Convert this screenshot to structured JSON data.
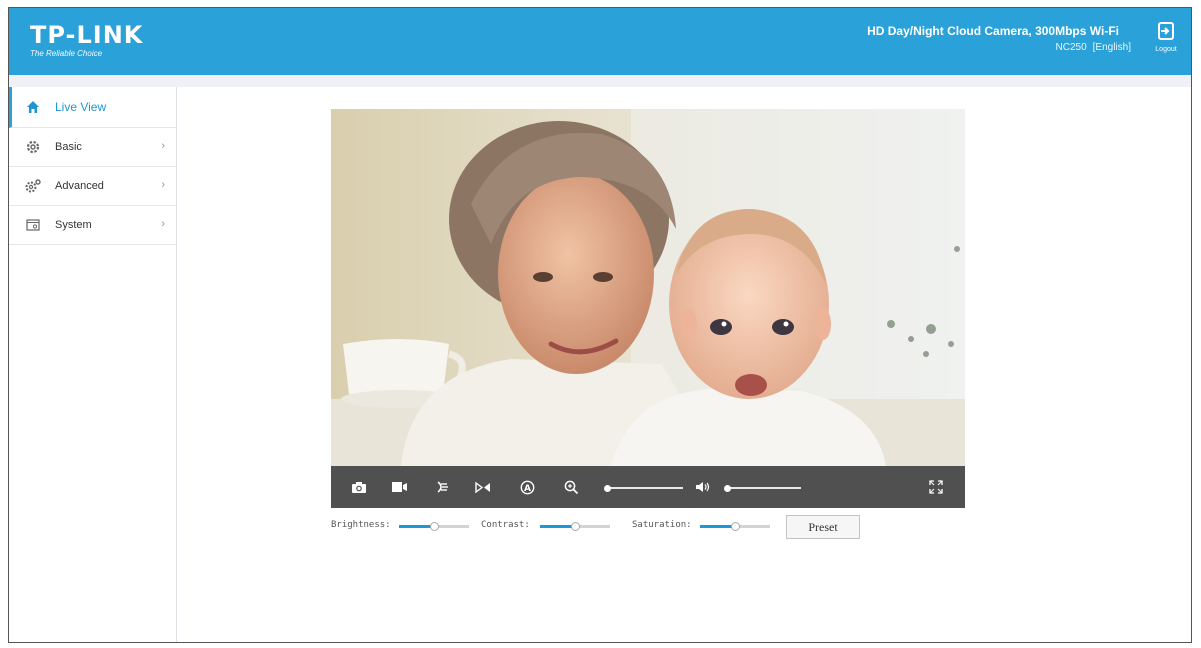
{
  "header": {
    "logo_main": "TP-LINK",
    "logo_sub": "The Reliable Choice",
    "product_title": "HD Day/Night Cloud Camera, 300Mbps Wi-Fi",
    "model": "NC250",
    "language": "[English]",
    "logout_label": "Logout",
    "background": "#2aa2d9"
  },
  "sidebar": {
    "items": [
      {
        "label": "Live View",
        "icon": "home-icon",
        "active": true
      },
      {
        "label": "Basic",
        "icon": "gear-icon"
      },
      {
        "label": "Advanced",
        "icon": "advanced-gear-icon"
      },
      {
        "label": "System",
        "icon": "system-icon"
      }
    ]
  },
  "player": {
    "controls": [
      "snapshot-icon",
      "record-icon",
      "night-vision-icon",
      "flip-icon",
      "auto-icon",
      "zoom-icon",
      "speaker-icon",
      "fullscreen-icon"
    ],
    "zoom_level": 0,
    "volume_level": 0
  },
  "adjustments": {
    "brightness_label": "Brightness:",
    "brightness": 0.5,
    "contrast_label": "Contrast:",
    "contrast": 0.5,
    "saturation_label": "Saturation:",
    "saturation": 0.5,
    "preset_label": "Preset"
  },
  "colors": {
    "accent": "#2aa2d9",
    "slider_fill": "#1b98d6",
    "control_bar": "#505050"
  }
}
